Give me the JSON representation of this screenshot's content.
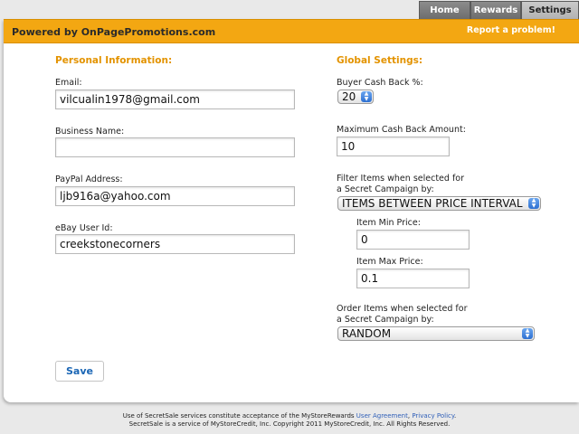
{
  "nav": {
    "tabs": [
      "Home",
      "Rewards",
      "Settings"
    ]
  },
  "header": {
    "powered_by": "Powered by OnPagePromotions.com",
    "report": "Report a problem!"
  },
  "personal": {
    "title": "Personal Information:",
    "email_label": "Email:",
    "email_value": "vilcualin1978@gmail.com",
    "business_label": "Business Name:",
    "business_value": "",
    "paypal_label": "PayPal Address:",
    "paypal_value": "ljb916a@yahoo.com",
    "ebay_label": "eBay User Id:",
    "ebay_value": "creekstonecorners"
  },
  "global": {
    "title": "Global Settings:",
    "cashback_label": "Buyer Cash Back %:",
    "cashback_value": "20",
    "max_label": "Maximum Cash Back Amount:",
    "max_value": "10",
    "filter_label_1": "Filter Items when selected for",
    "filter_label_2": "a Secret Campaign by:",
    "filter_value": "ITEMS BETWEEN PRICE INTERVAL",
    "min_label": "Item Min Price:",
    "min_value": "0",
    "maxprice_label": "Item Max Price:",
    "maxprice_value": "0.1",
    "order_label_1": "Order Items when selected for",
    "order_label_2": "a Secret Campaign by:",
    "order_value": "RANDOM"
  },
  "save_label": "Save",
  "footer": {
    "line1_a": "Use of SecretSale services constitute acceptance of the MyStoreRewards ",
    "agreement": "User Agreement",
    "comma": ", ",
    "privacy": "Privacy Policy",
    "period": ".",
    "line2": "SecretSale is a service of MyStoreCredit, Inc. Copyright 2011 MyStoreCredit, Inc. All Rights Reserved."
  }
}
